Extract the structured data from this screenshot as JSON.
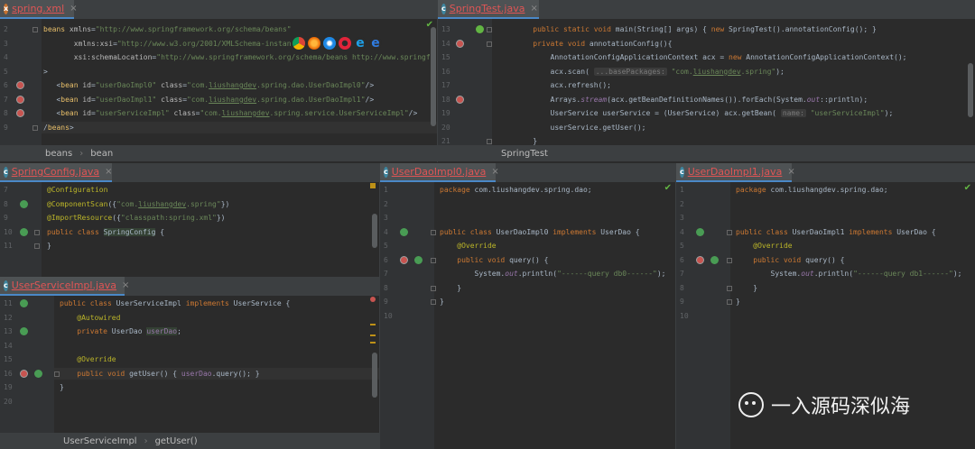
{
  "panes": {
    "spring_xml": {
      "tab": "spring.xml",
      "lines": [
        {
          "n": "2",
          "html": "<span class='tag'>beans</span> <span class='at'>xmlns</span>=<span class='str'>\"http://www.springframework.org/schema/beans\"</span>"
        },
        {
          "n": "3",
          "html": "       <span class='at'>xmlns:xsi</span>=<span class='str'>\"http://www.w3.org/2001/XMLSchema-instan</span>"
        },
        {
          "n": "4",
          "html": "       <span class='at'>xsi:schemaLocation</span>=<span class='str'>\"http://www.springframework.org/schema/beans http://www.springf</span>"
        },
        {
          "n": "5",
          "html": ">"
        },
        {
          "n": "6",
          "html": "   &lt;<span class='tag'>bean</span> <span class='at'>id</span>=<span class='str'>\"userDaoImpl0\"</span> <span class='at'>class</span>=<span class='str'>\"com.<span class='ul'>liushangdev</span>.spring.dao.UserDaoImpl0\"</span>/&gt;"
        },
        {
          "n": "7",
          "html": "   &lt;<span class='tag'>bean</span> <span class='at'>id</span>=<span class='str'>\"userDaoImpl1\"</span> <span class='at'>class</span>=<span class='str'>\"com.<span class='ul'>liushangdev</span>.spring.dao.UserDaoImpl1\"</span>/&gt;"
        },
        {
          "n": "8",
          "html": "   &lt;<span class='tag'>bean</span> <span class='at'>id</span>=<span class='str'>\"userServiceImpl\"</span> <span class='at'>class</span>=<span class='str'>\"com.<span class='ul'>liushangdev</span>.spring.service.UserServiceImpl\"</span>/&gt;"
        },
        {
          "n": "9",
          "html": "/<span class='tag'>beans</span>&gt;"
        }
      ],
      "breadcrumbs": [
        "beans",
        "bean"
      ]
    },
    "spring_test": {
      "tab": "SpringTest.java",
      "lines": [
        {
          "n": "13",
          "html": "    <span class='kw'>public static void</span> main(String[] args) { <span class='kw'>new</span> SpringTest().annotationConfig(); }"
        },
        {
          "n": "14",
          "html": "    <span class='kw'>private void</span> annotationConfig(){"
        },
        {
          "n": "15",
          "html": "        AnnotationConfigApplicationContext acx = <span class='kw'>new</span> AnnotationConfigApplicationContext();"
        },
        {
          "n": "16",
          "html": "        acx.scan( <span class='hint'>...basePackages:</span> <span class='str'>\"com.<span class='ul'>liushangdev</span>.spring\"</span>);"
        },
        {
          "n": "17",
          "html": "        acx.refresh();"
        },
        {
          "n": "18",
          "html": "        Arrays.<span class='it'>stream</span>(acx.getBeanDefinitionNames()).forEach(System.<span class='it'>out</span>::println);"
        },
        {
          "n": "19",
          "html": "        UserService userService = (UserService) acx.getBean( <span class='hint'>name:</span> <span class='str'>\"userServiceImpl\"</span>);"
        },
        {
          "n": "20",
          "html": "        userService.getUser();"
        },
        {
          "n": "21",
          "html": "    }"
        }
      ],
      "breadcrumbs": [
        "SpringTest"
      ]
    },
    "spring_config": {
      "tab": "SpringConfig.java",
      "lines": [
        {
          "n": "7",
          "html": "<span class='ann'>@Configuration</span>"
        },
        {
          "n": "8",
          "html": "<span class='ann'>@ComponentScan</span>({<span class='str'>\"com.<span class='ul'>liushangdev</span>.spring\"</span>})"
        },
        {
          "n": "9",
          "html": "<span class='ann'>@ImportResource</span>({<span class='str'>\"classpath:spring.xml\"</span>})"
        },
        {
          "n": "10",
          "html": "<span class='kw'>public class</span> <span style='background:#344134'>SpringConfig</span> {"
        },
        {
          "n": "11",
          "html": "}"
        }
      ]
    },
    "user_service": {
      "tab": "UserServiceImpl.java",
      "lines": [
        {
          "n": "11",
          "html": "<span class='kw'>public class</span> UserServiceImpl <span class='kw'>implements</span> UserService {"
        },
        {
          "n": "12",
          "html": "    <span class='ann'>@Autowired</span>"
        },
        {
          "n": "13",
          "html": "    <span class='kw'>private</span> UserDao <span class='fld' style='background:#344134'>userDao</span>;"
        },
        {
          "n": "14",
          "html": ""
        },
        {
          "n": "15",
          "html": "    <span class='ann'>@Override</span>"
        },
        {
          "n": "16",
          "html": "    <span class='kw'>public void</span> getUser() { <span class='fld'>userDao</span>.query(); }"
        },
        {
          "n": "19",
          "html": "}"
        },
        {
          "n": "20",
          "html": ""
        }
      ],
      "breadcrumbs": [
        "UserServiceImpl",
        "getUser()"
      ]
    },
    "dao0": {
      "tab": "UserDaoImpl0.java",
      "lines": [
        {
          "n": "1",
          "html": "<span class='kw'>package</span> com.liushangdev.spring.dao;"
        },
        {
          "n": "2",
          "html": ""
        },
        {
          "n": "3",
          "html": ""
        },
        {
          "n": "4",
          "html": "<span class='kw'>public class</span> UserDaoImpl0 <span class='kw'>implements</span> UserDao {"
        },
        {
          "n": "5",
          "html": "    <span class='ann'>@Override</span>"
        },
        {
          "n": "6",
          "html": "    <span class='kw'>public void</span> query() {"
        },
        {
          "n": "7",
          "html": "        System.<span class='it'>out</span>.println(<span class='str'>\"------query db0------\"</span>);"
        },
        {
          "n": "8",
          "html": "    }"
        },
        {
          "n": "9",
          "html": "}"
        },
        {
          "n": "10",
          "html": ""
        }
      ]
    },
    "dao1": {
      "tab": "UserDaoImpl1.java",
      "lines": [
        {
          "n": "1",
          "html": "<span class='kw'>package</span> com.liushangdev.spring.dao;"
        },
        {
          "n": "2",
          "html": ""
        },
        {
          "n": "3",
          "html": ""
        },
        {
          "n": "4",
          "html": "<span class='kw'>public class</span> UserDaoImpl1 <span class='kw'>implements</span> UserDao {"
        },
        {
          "n": "5",
          "html": "    <span class='ann'>@Override</span>"
        },
        {
          "n": "6",
          "html": "    <span class='kw'>public void</span> query() {"
        },
        {
          "n": "7",
          "html": "        System.<span class='it'>out</span>.println(<span class='str'>\"------query db1------\"</span>);"
        },
        {
          "n": "8",
          "html": "    }"
        },
        {
          "n": "9",
          "html": "}"
        },
        {
          "n": "10",
          "html": ""
        }
      ]
    }
  },
  "watermark": "一入源码深似海",
  "colors": {
    "keyword": "#cc7832",
    "string": "#6a8759",
    "annotation": "#bbb529",
    "tab_error": "#e05555"
  }
}
